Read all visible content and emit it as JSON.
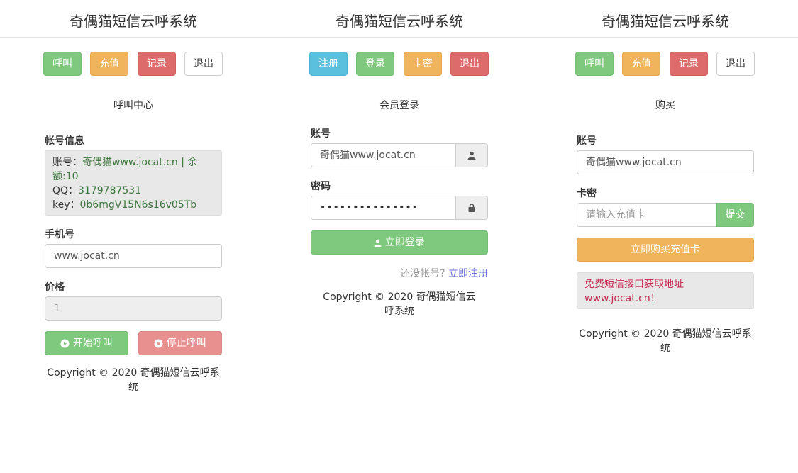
{
  "app_title": "奇偶猫短信云呼系统",
  "panel_left": {
    "nav": {
      "call": "呼叫",
      "recharge": "充值",
      "record": "记录",
      "logout": "退出"
    },
    "section_title": "呼叫中心",
    "account_info_label": "帐号信息",
    "account_info": {
      "account_key": "账号：",
      "account_val": "奇偶猫www.jocat.cn",
      "sep": " | 余",
      "balance_line": "额:10",
      "qq_key": "QQ：",
      "qq_val": "3179787531",
      "key_key": "key：",
      "key_val": "0b6mgV15N6s16v05Tb"
    },
    "phone_label": "手机号",
    "phone_value": "www.jocat.cn",
    "price_label": "价格",
    "price_value": "1",
    "start_call": "开始呼叫",
    "stop_call": "停止呼叫",
    "copyright_line1": "Copyright © 2020 奇偶猫短信云呼系",
    "copyright_line2": "统"
  },
  "panel_middle": {
    "nav": {
      "register": "注册",
      "login": "登录",
      "card": "卡密",
      "logout": "退出"
    },
    "section_title": "会员登录",
    "account_label": "账号",
    "account_value": "奇偶猫www.jocat.cn",
    "password_label": "密码",
    "password_value": "•••••••••••••••",
    "login_button": "立即登录",
    "no_account_text": "还没帐号?",
    "register_link": "立即注册",
    "copyright_line1": "Copyright © 2020 奇偶猫短信云",
    "copyright_line2": "呼系统"
  },
  "panel_right": {
    "nav": {
      "call": "呼叫",
      "recharge": "充值",
      "record": "记录",
      "logout": "退出"
    },
    "section_title": "购买",
    "account_label": "账号",
    "account_value": "奇偶猫www.jocat.cn",
    "card_label": "卡密",
    "card_placeholder": "请输入充值卡",
    "submit_button": "提交",
    "buy_button": "立即购买充值卡",
    "alert_line1": "免费短信接口获取地址",
    "alert_line2": "www.jocat.cn！",
    "copyright": "Copyright © 2020 奇偶猫短信云呼系统"
  },
  "colors": {
    "green": "#7fc97f",
    "orange": "#f0b45c",
    "red": "#de6b6b",
    "blue": "#5bc0de",
    "pink": "#e89090",
    "value_green": "#3c763d",
    "alert_red": "#c7254e",
    "link": "#6a6ade"
  },
  "icons": {
    "user": "user-icon",
    "lock": "lock-icon",
    "play": "play-circle-icon",
    "stop": "stop-circle-icon"
  }
}
